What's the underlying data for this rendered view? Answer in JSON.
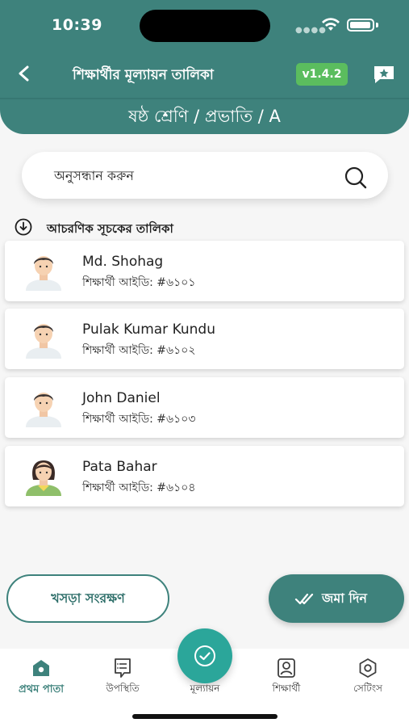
{
  "status_bar": {
    "time": "10:39"
  },
  "header": {
    "title": "শিক্ষার্থীর মূল্যায়ন তালিকা",
    "version": "v1.4.2",
    "class_info": "ষষ্ঠ শ্রেণি / প্রভাতি / A"
  },
  "search": {
    "placeholder": "অনুসন্ধান করুন"
  },
  "list": {
    "heading": "আচরণিক সূচকের তালিকা",
    "students": [
      {
        "name": "Md. Shohag",
        "id_label": "শিক্ষার্থী আইডি: #৬১০১",
        "avatar": "boy"
      },
      {
        "name": "Pulak Kumar Kundu",
        "id_label": "শিক্ষার্থী আইডি: #৬১০২",
        "avatar": "boy"
      },
      {
        "name": "John Daniel",
        "id_label": "শিক্ষার্থী আইডি: #৬১০৩",
        "avatar": "boy"
      },
      {
        "name": "Pata Bahar",
        "id_label": "শিক্ষার্থী আইডি: #৬১০৪",
        "avatar": "girl"
      }
    ]
  },
  "actions": {
    "save_draft": "খসড়া সংরক্ষণ",
    "submit": "জমা দিন"
  },
  "bottom_nav": {
    "items": [
      {
        "label": "প্রথম পাতা",
        "icon": "home-icon"
      },
      {
        "label": "উপস্থিতি",
        "icon": "attendance-icon"
      },
      {
        "label": "মূল্যায়ন",
        "icon": "check-circle-icon"
      },
      {
        "label": "শিক্ষার্থী",
        "icon": "student-icon"
      },
      {
        "label": "সেটিংস",
        "icon": "settings-icon"
      }
    ]
  },
  "colors": {
    "primary": "#3e827c",
    "accent": "#2ba69a",
    "version_badge": "#5bbd5e"
  }
}
